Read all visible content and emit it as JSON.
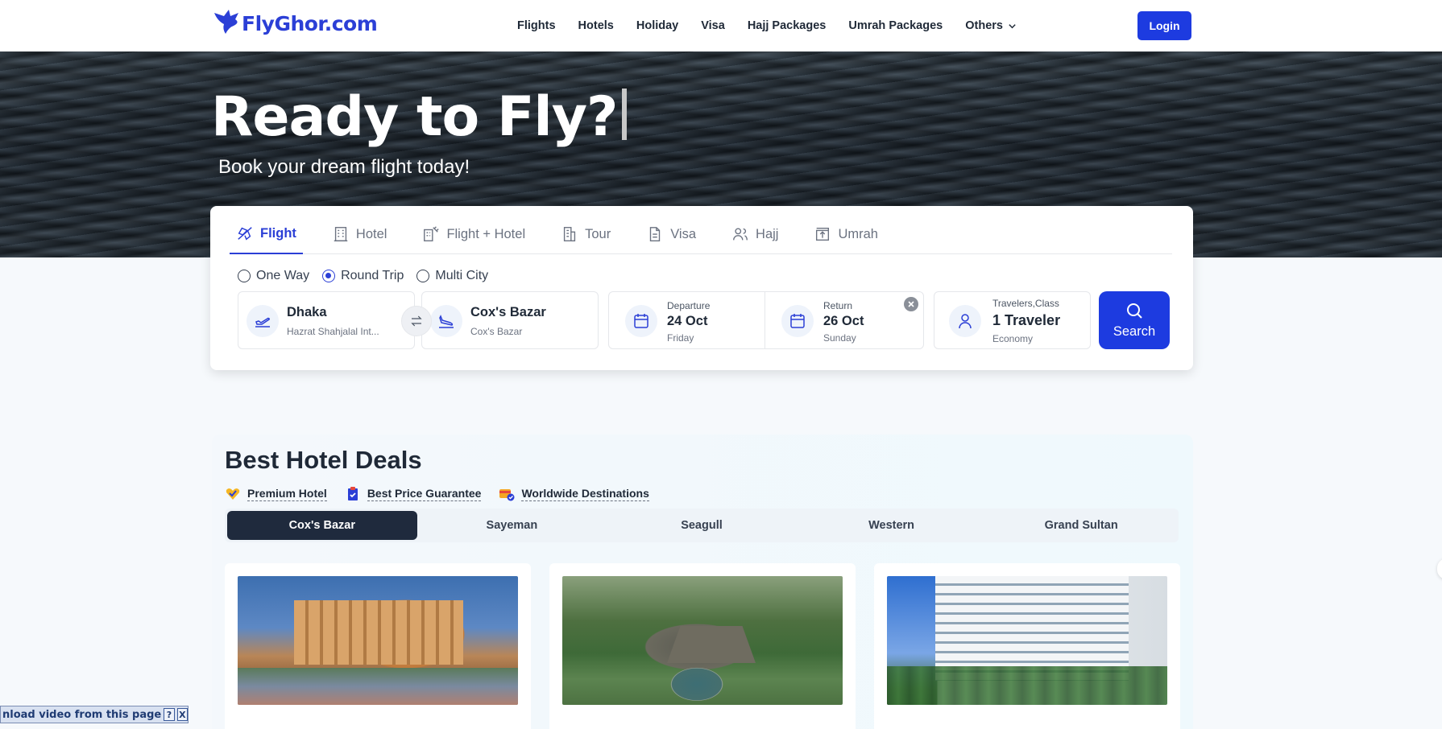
{
  "header": {
    "logo_text": "FlyGhor.com",
    "nav": [
      "Flights",
      "Hotels",
      "Holiday",
      "Visa",
      "Hajj Packages",
      "Umrah Packages"
    ],
    "nav_more": "Others",
    "login_label": "Login"
  },
  "hero": {
    "title": "Ready to Fly?",
    "subtitle": "Book your dream flight today!"
  },
  "search": {
    "tabs": [
      {
        "label": "Flight",
        "icon": "plane-icon",
        "active": true
      },
      {
        "label": "Hotel",
        "icon": "building-icon",
        "active": false
      },
      {
        "label": "Flight + Hotel",
        "icon": "hotel-plane-icon",
        "active": false
      },
      {
        "label": "Tour",
        "icon": "tour-icon",
        "active": false
      },
      {
        "label": "Visa",
        "icon": "document-icon",
        "active": false
      },
      {
        "label": "Hajj",
        "icon": "people-icon",
        "active": false
      },
      {
        "label": "Umrah",
        "icon": "kaaba-icon",
        "active": false
      }
    ],
    "trip_types": [
      {
        "label": "One Way",
        "selected": false
      },
      {
        "label": "Round Trip",
        "selected": true
      },
      {
        "label": "Multi City",
        "selected": false
      }
    ],
    "from": {
      "city": "Dhaka",
      "airport": "Hazrat Shahjalal Int..."
    },
    "to": {
      "city": "Cox's Bazar",
      "airport": "Cox's Bazar"
    },
    "departure": {
      "label": "Departure",
      "date": "24 Oct",
      "day": "Friday"
    },
    "return": {
      "label": "Return",
      "date": "26 Oct",
      "day": "Sunday"
    },
    "travelers": {
      "label": "Travelers,Class",
      "count": "1 Traveler",
      "class": "Economy"
    },
    "search_label": "Search"
  },
  "deals": {
    "title": "Best Hotel Deals",
    "badges": [
      "Premium Hotel",
      "Best Price Guarantee",
      "Worldwide Destinations"
    ],
    "locations": [
      {
        "label": "Cox's Bazar",
        "active": true
      },
      {
        "label": "Sayeman",
        "active": false
      },
      {
        "label": "Seagull",
        "active": false
      },
      {
        "label": "Western",
        "active": false
      },
      {
        "label": "Grand Sultan",
        "active": false
      }
    ]
  },
  "download_bar": {
    "text": "nload video from this page",
    "help": "?",
    "close": "X"
  },
  "colors": {
    "accent": "#1d3be0",
    "brand": "#2b3fd6",
    "dark_tab": "#1f2a3d"
  }
}
